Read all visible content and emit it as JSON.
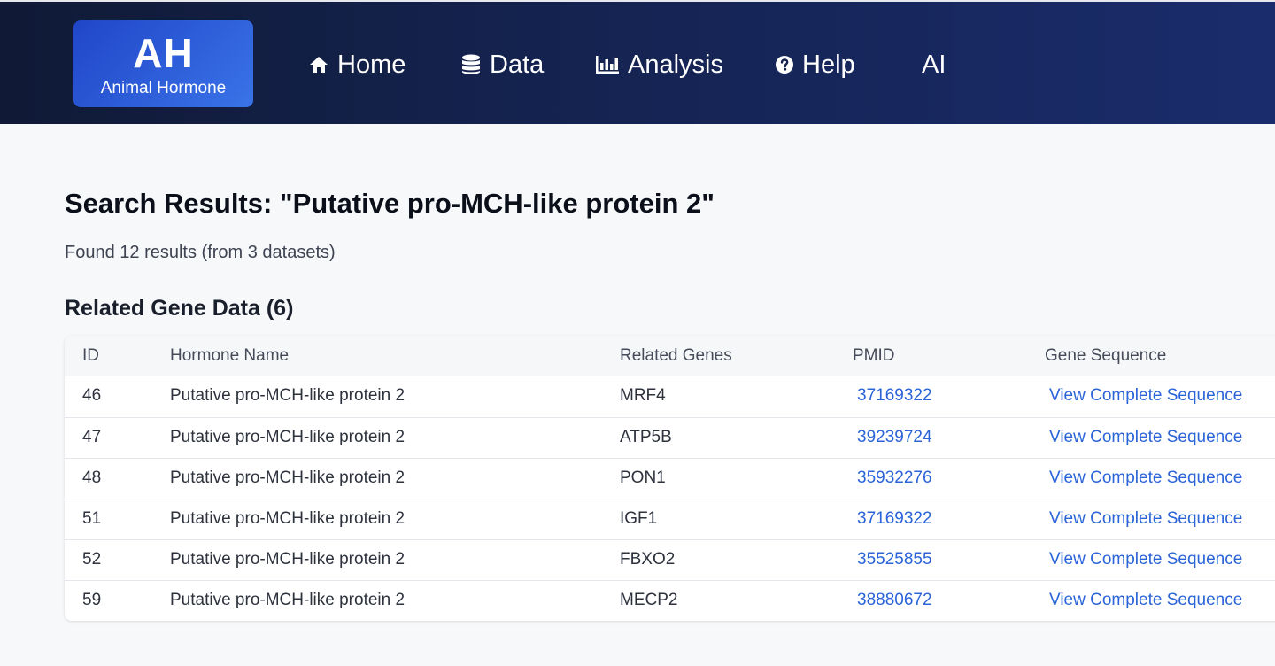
{
  "brand": {
    "mark": "AH",
    "subtitle": "Animal Hormone"
  },
  "nav": {
    "home": {
      "label": "Home",
      "icon": "home-icon"
    },
    "data": {
      "label": "Data",
      "icon": "database-icon"
    },
    "analysis": {
      "label": "Analysis",
      "icon": "bar-chart-icon"
    },
    "help": {
      "label": "Help",
      "icon": "question-circle-icon"
    },
    "ai": {
      "label": "AI"
    }
  },
  "search": {
    "title": "Search Results: \"Putative pro-MCH-like protein 2\"",
    "summary": "Found 12 results (from 3 datasets)"
  },
  "gene_section": {
    "title": "Related Gene Data (6)",
    "columns": [
      "ID",
      "Hormone Name",
      "Related Genes",
      "PMID",
      "Gene Sequence"
    ],
    "rows": [
      {
        "id": "46",
        "hormone": "Putative pro-MCH-like protein 2",
        "genes": "MRF4",
        "pmid": "37169322",
        "sequence_link": "View Complete Sequence"
      },
      {
        "id": "47",
        "hormone": "Putative pro-MCH-like protein 2",
        "genes": "ATP5B",
        "pmid": "39239724",
        "sequence_link": "View Complete Sequence"
      },
      {
        "id": "48",
        "hormone": "Putative pro-MCH-like protein 2",
        "genes": "PON1",
        "pmid": "35932276",
        "sequence_link": "View Complete Sequence"
      },
      {
        "id": "51",
        "hormone": "Putative pro-MCH-like protein 2",
        "genes": "IGF1",
        "pmid": "37169322",
        "sequence_link": "View Complete Sequence"
      },
      {
        "id": "52",
        "hormone": "Putative pro-MCH-like protein 2",
        "genes": "FBXO2",
        "pmid": "35525855",
        "sequence_link": "View Complete Sequence"
      },
      {
        "id": "59",
        "hormone": "Putative pro-MCH-like protein 2",
        "genes": "MECP2",
        "pmid": "38880672",
        "sequence_link": "View Complete Sequence"
      }
    ]
  },
  "colors": {
    "nav_gradient_start": "#101a36",
    "nav_gradient_end": "#1a2c6c",
    "logo_blue": "#2f5fe0",
    "link_blue": "#2a64d8",
    "page_background": "#f7f8fa"
  }
}
